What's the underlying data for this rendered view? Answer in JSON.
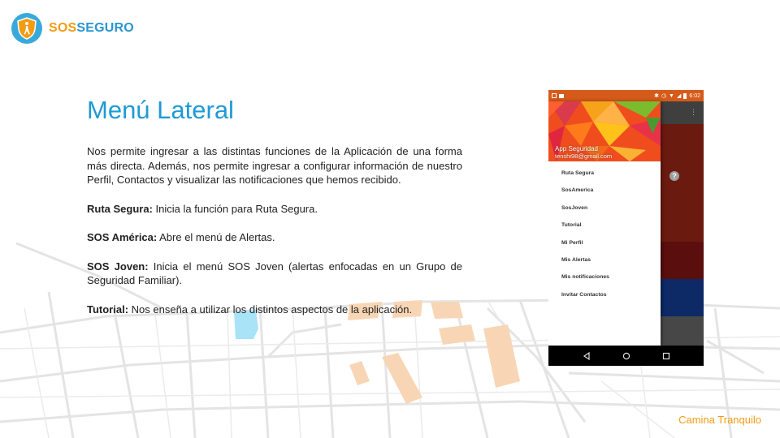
{
  "brand": {
    "sos": "SOS",
    "seguro": "SEGURO"
  },
  "slide": {
    "title": "Menú Lateral",
    "intro": "Nos permite ingresar a las distintas funciones de la Aplicación de una forma más directa. Además, nos permite ingresar a configurar información de nuestro Perfil, Contactos y visualizar las notificaciones que hemos recibido.",
    "items": [
      {
        "term": "Ruta Segura:",
        "text": " Inicia la función para Ruta Segura."
      },
      {
        "term": "SOS América:",
        "text": " Abre el menú de Alertas."
      },
      {
        "term": "SOS Joven:",
        "text": " Inicia el menú SOS Joven (alertas enfocadas en un Grupo de Seguridad Familiar)."
      },
      {
        "term": "Tutorial:",
        "text": " Nos enseña a utilizar los distintos aspectos de la aplicación."
      }
    ]
  },
  "phone": {
    "time": "6:02",
    "user_name": "App Seguridad",
    "user_email": "tenshi98@gmail.com",
    "help_glyph": "?",
    "menu": [
      "Ruta Segura",
      "SosAmerica",
      "SosJoven",
      "Tutorial",
      "Mi Perfil",
      "Mis Alertas",
      "Mis notificaciones",
      "Invitar Contactos"
    ]
  },
  "footer": {
    "tagline": "Camina Tranquilo"
  },
  "colors": {
    "accent": "#1e9ad6",
    "orange": "#f39c12",
    "statusbar": "#d65a1a"
  }
}
